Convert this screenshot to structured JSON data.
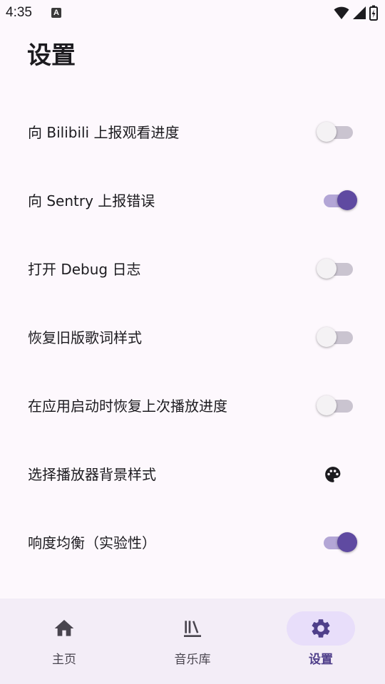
{
  "status_bar": {
    "time": "4:35",
    "notification_icon": "A",
    "icons": [
      "wifi-icon",
      "signal-icon",
      "battery-icon"
    ]
  },
  "page": {
    "title": "设置"
  },
  "settings": [
    {
      "label": "向 Bilibili 上报观看进度",
      "control": "switch",
      "checked": false
    },
    {
      "label": "向 Sentry 上报错误",
      "control": "switch",
      "checked": true
    },
    {
      "label": "打开 Debug 日志",
      "control": "switch",
      "checked": false
    },
    {
      "label": "恢复旧版歌词样式",
      "control": "switch",
      "checked": false
    },
    {
      "label": "在应用启动时恢复上次播放进度",
      "control": "switch",
      "checked": false
    },
    {
      "label": "选择播放器背景样式",
      "control": "palette-icon"
    },
    {
      "label": "响度均衡（实验性）",
      "control": "switch",
      "checked": true
    }
  ],
  "bottom_nav": [
    {
      "label": "主页",
      "icon": "home-icon",
      "active": false
    },
    {
      "label": "音乐库",
      "icon": "library-icon",
      "active": false
    },
    {
      "label": "设置",
      "icon": "gear-icon",
      "active": true
    }
  ],
  "colors": {
    "background": "#fdf8fd",
    "accent": "#5f4aa1",
    "switch_on_track": "#b3a6d6",
    "nav_background": "#f3edf7",
    "nav_active_pill": "#e8defa"
  }
}
